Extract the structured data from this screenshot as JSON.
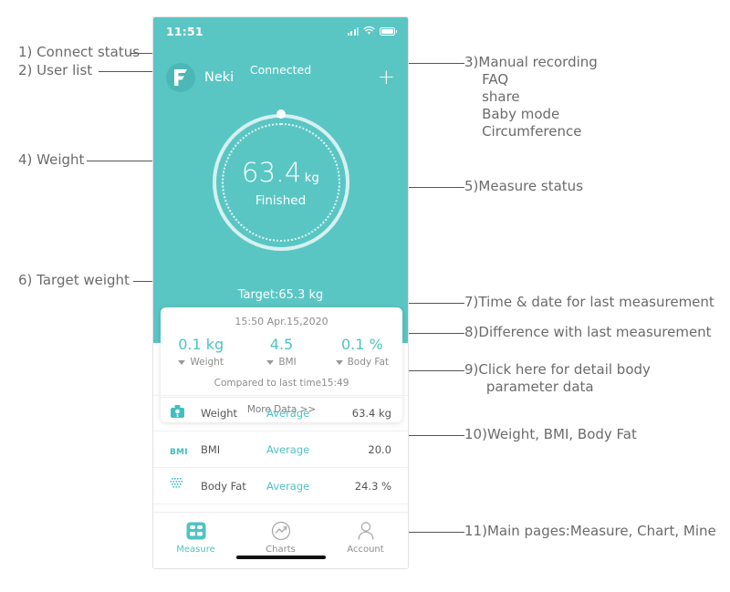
{
  "phone": {
    "statusbar": {
      "time": "11:51",
      "signal_icon": "signal-bars-icon",
      "wifi_icon": "wifi-icon",
      "battery_icon": "battery-icon"
    },
    "header": {
      "connect_status": "Connected",
      "user_name": "Neki",
      "logo_icon": "neki-logo-icon",
      "add_label": "+"
    },
    "dial": {
      "weight_value": "63.4",
      "weight_unit": "kg",
      "measure_status": "Finished"
    },
    "target": "Target:65.3 kg",
    "card": {
      "timestamp": "15:50 Apr.15,2020",
      "deltas": [
        {
          "value": "0.1 kg",
          "label": "Weight"
        },
        {
          "value": "4.5",
          "label": "BMI"
        },
        {
          "value": "0.1 %",
          "label": "Body Fat"
        }
      ],
      "compared": "Compared to last time15:49",
      "more_data": "More Data >>"
    },
    "rows": [
      {
        "icon": "scale-icon",
        "name": "Weight",
        "avg": "Average",
        "value": "63.4 kg"
      },
      {
        "icon": "bmi-icon",
        "name": "BMI",
        "avg": "Average",
        "value": "20.0"
      },
      {
        "icon": "bodyfat-icon",
        "name": "Body Fat",
        "avg": "Average",
        "value": "24.3 %"
      }
    ],
    "tabs": [
      {
        "label": "Measure",
        "icon": "scale-tab-icon",
        "active": true
      },
      {
        "label": "Charts",
        "icon": "chart-tab-icon",
        "active": false
      },
      {
        "label": "Account",
        "icon": "person-tab-icon",
        "active": false
      }
    ]
  },
  "annotations": {
    "a1": "1) Connect status",
    "a2": "2) User list",
    "a3": "3)Manual recording\n    FAQ\n    share\n    Baby mode\n    Circumference",
    "a4": "4) Weight",
    "a5": "5)Measure status",
    "a6": "6) Target weight",
    "a7": "7)Time & date for last measurement",
    "a8": "8)Difference with last measurement",
    "a9": "9)Click here for detail body\n     parameter data",
    "a10": "10)Weight, BMI, Body Fat",
    "a11": "11)Main pages:Measure, Chart, Mine"
  },
  "colors": {
    "teal": "#5ac6c4",
    "accent": "#4ec3c2",
    "text_gray": "#6b6b6b"
  }
}
